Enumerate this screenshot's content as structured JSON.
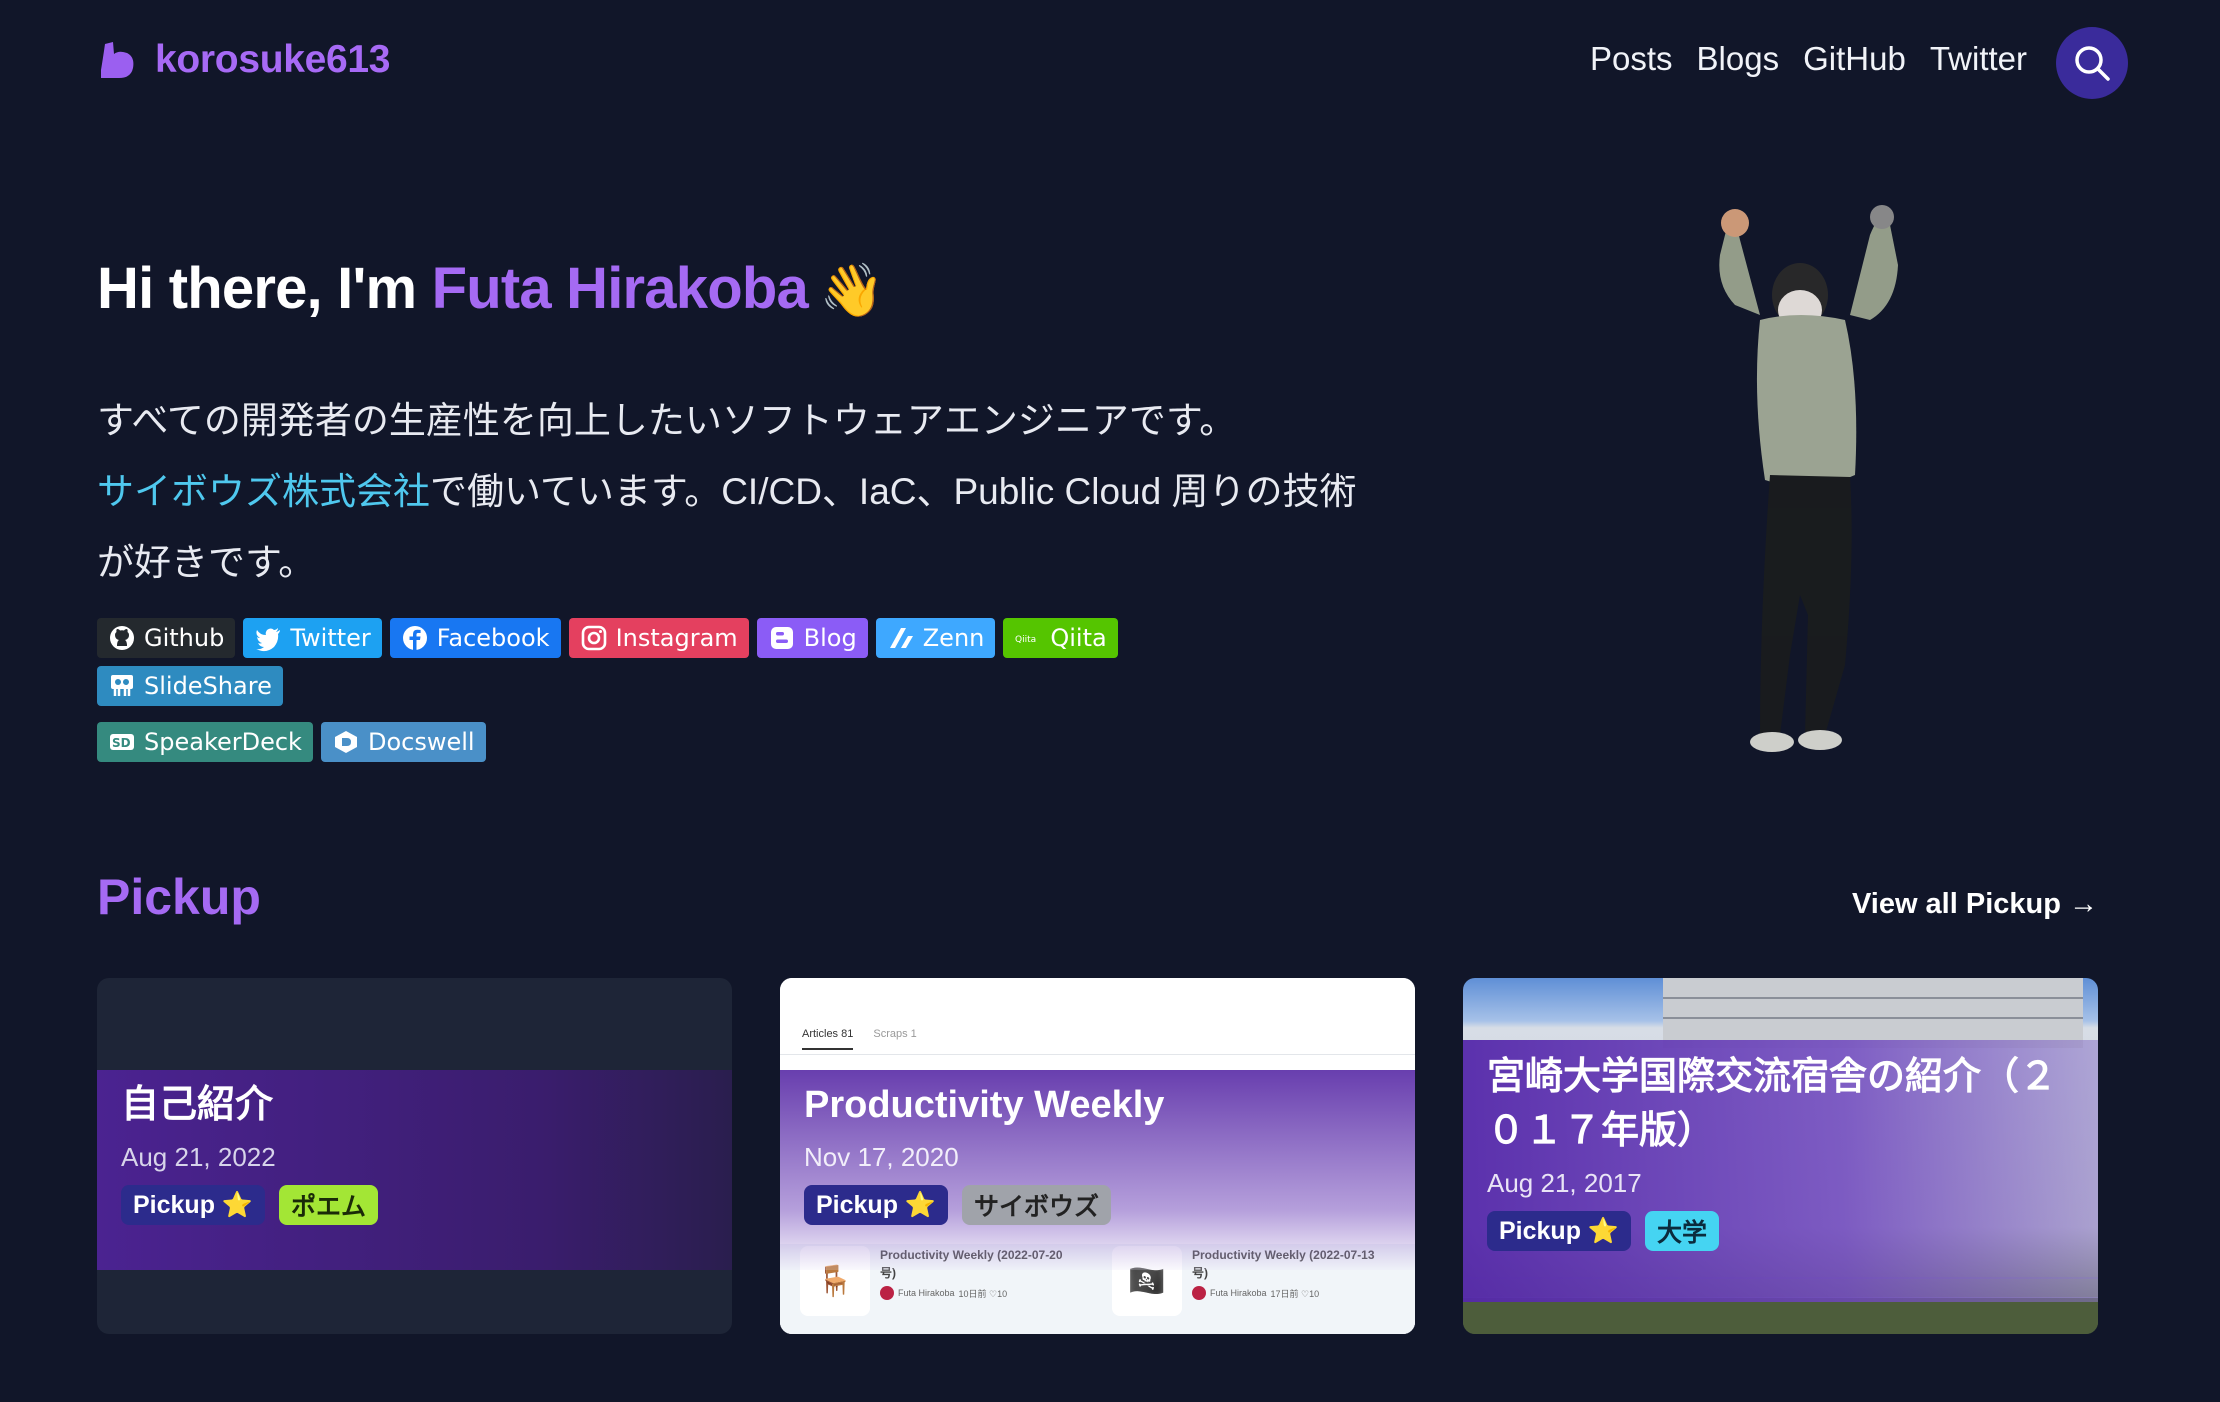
{
  "header": {
    "brand": "korosuke613",
    "nav": [
      "Posts",
      "Blogs",
      "GitHub",
      "Twitter"
    ]
  },
  "hero": {
    "greeting": "Hi there, I'm ",
    "name": "Futa Hirakoba",
    "wave": "👋",
    "bio_line1": "すべての開発者の生産性を向上したいソフトウェアエンジニアです。",
    "company": "サイボウズ株式会社",
    "bio_rest": "で働いています。CI/CD、IaC、Public Cloud 周りの技術が好きです。"
  },
  "badges": [
    {
      "label": "Github",
      "color": "#24292e",
      "icon": "github-icon"
    },
    {
      "label": "Twitter",
      "color": "#1da1f2",
      "icon": "twitter-icon"
    },
    {
      "label": "Facebook",
      "color": "#1877f2",
      "icon": "facebook-icon"
    },
    {
      "label": "Instagram",
      "color": "#e4405f",
      "icon": "instagram-icon"
    },
    {
      "label": "Blog",
      "color": "#8b5cf6",
      "icon": "blogger-icon"
    },
    {
      "label": "Zenn",
      "color": "#3ea8ff",
      "icon": "zenn-icon"
    },
    {
      "label": "Qiita",
      "color": "#55c500",
      "icon": "qiita-icon"
    },
    {
      "label": "SlideShare",
      "color": "#2e8bc0",
      "icon": "slideshare-icon"
    },
    {
      "label": "SpeakerDeck",
      "color": "#358a7f",
      "icon": "speakerdeck-icon"
    },
    {
      "label": "Docswell",
      "color": "#4a90c8",
      "icon": "docswell-icon"
    }
  ],
  "pickup": {
    "title": "Pickup",
    "view_all": "View all Pickup →",
    "cards": [
      {
        "title": "自己紹介",
        "date": "Aug 21, 2022",
        "tags": [
          "Pickup ⭐",
          "ポエム"
        ]
      },
      {
        "title": "Productivity Weekly",
        "date": "Nov 17, 2020",
        "tags": [
          "Pickup ⭐",
          "サイボウズ"
        ],
        "screenshot": {
          "tab_articles": "Articles 81",
          "tab_scraps": "Scraps 1",
          "items": [
            {
              "title": "Productivity Weekly (2022-07-20号)",
              "author": "Futa Hirakoba",
              "meta": "10日前 ♡10"
            },
            {
              "title": "Productivity Weekly (2022-07-13号)",
              "author": "Futa Hirakoba",
              "meta": "17日前 ♡10"
            }
          ]
        }
      },
      {
        "title": "宮崎大学国際交流宿舎の紹介（２０１７年版）",
        "date": "Aug 21, 2017",
        "tags": [
          "Pickup ⭐",
          "大学"
        ]
      }
    ]
  }
}
